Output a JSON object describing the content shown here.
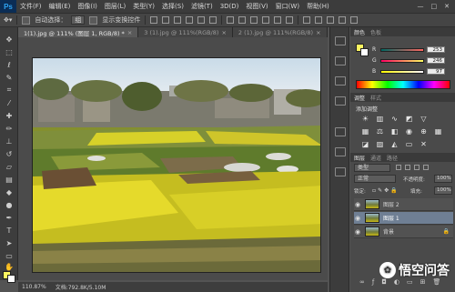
{
  "menu": {
    "app_logo": "Ps",
    "items": [
      "文件(F)",
      "编辑(E)",
      "图像(I)",
      "图层(L)",
      "类型(Y)",
      "选择(S)",
      "滤镜(T)",
      "3D(D)",
      "视图(V)",
      "窗口(W)",
      "帮助(H)"
    ],
    "window_controls": [
      "—",
      "□",
      "✕"
    ]
  },
  "options": {
    "auto_select_label": "自动选择：",
    "auto_select_value": "组",
    "show_transform_label": "显示变换控件"
  },
  "tabs": [
    {
      "label": "1(1).jpg @ 111% (图层 1, RGB/8) *",
      "active": true
    },
    {
      "label": "3 (1).jpg @ 111%(RGB/8)",
      "active": false
    },
    {
      "label": "2 (1).jpg @ 111%(RGB/8)",
      "active": false
    }
  ],
  "status": {
    "zoom": "110.87%",
    "doc_info": "文档:792.8K/5.10M"
  },
  "color_panel": {
    "tab_color": "颜色",
    "tab_swatches": "色板",
    "r_label": "R",
    "r_value": "253",
    "g_label": "G",
    "g_value": "246",
    "b_label": "B",
    "b_value": "97",
    "foreground": "#fdf661",
    "background": "#ffffff"
  },
  "adjust_panel": {
    "tab_adjust": "调整",
    "tab_styles": "样式",
    "title": "添加调整"
  },
  "layers_panel": {
    "tab_layers": "图层",
    "tab_channels": "通道",
    "tab_paths": "路径",
    "kind_label": "类型",
    "blend_mode": "正常",
    "opacity_label": "不透明度:",
    "opacity_value": "100%",
    "lock_label": "锁定:",
    "fill_label": "填充:",
    "fill_value": "100%",
    "layers": [
      {
        "name": "图层 2",
        "selected": false
      },
      {
        "name": "图层 1",
        "selected": true
      },
      {
        "name": "背景",
        "selected": false
      }
    ]
  },
  "watermark": {
    "text": "悟空问答"
  }
}
